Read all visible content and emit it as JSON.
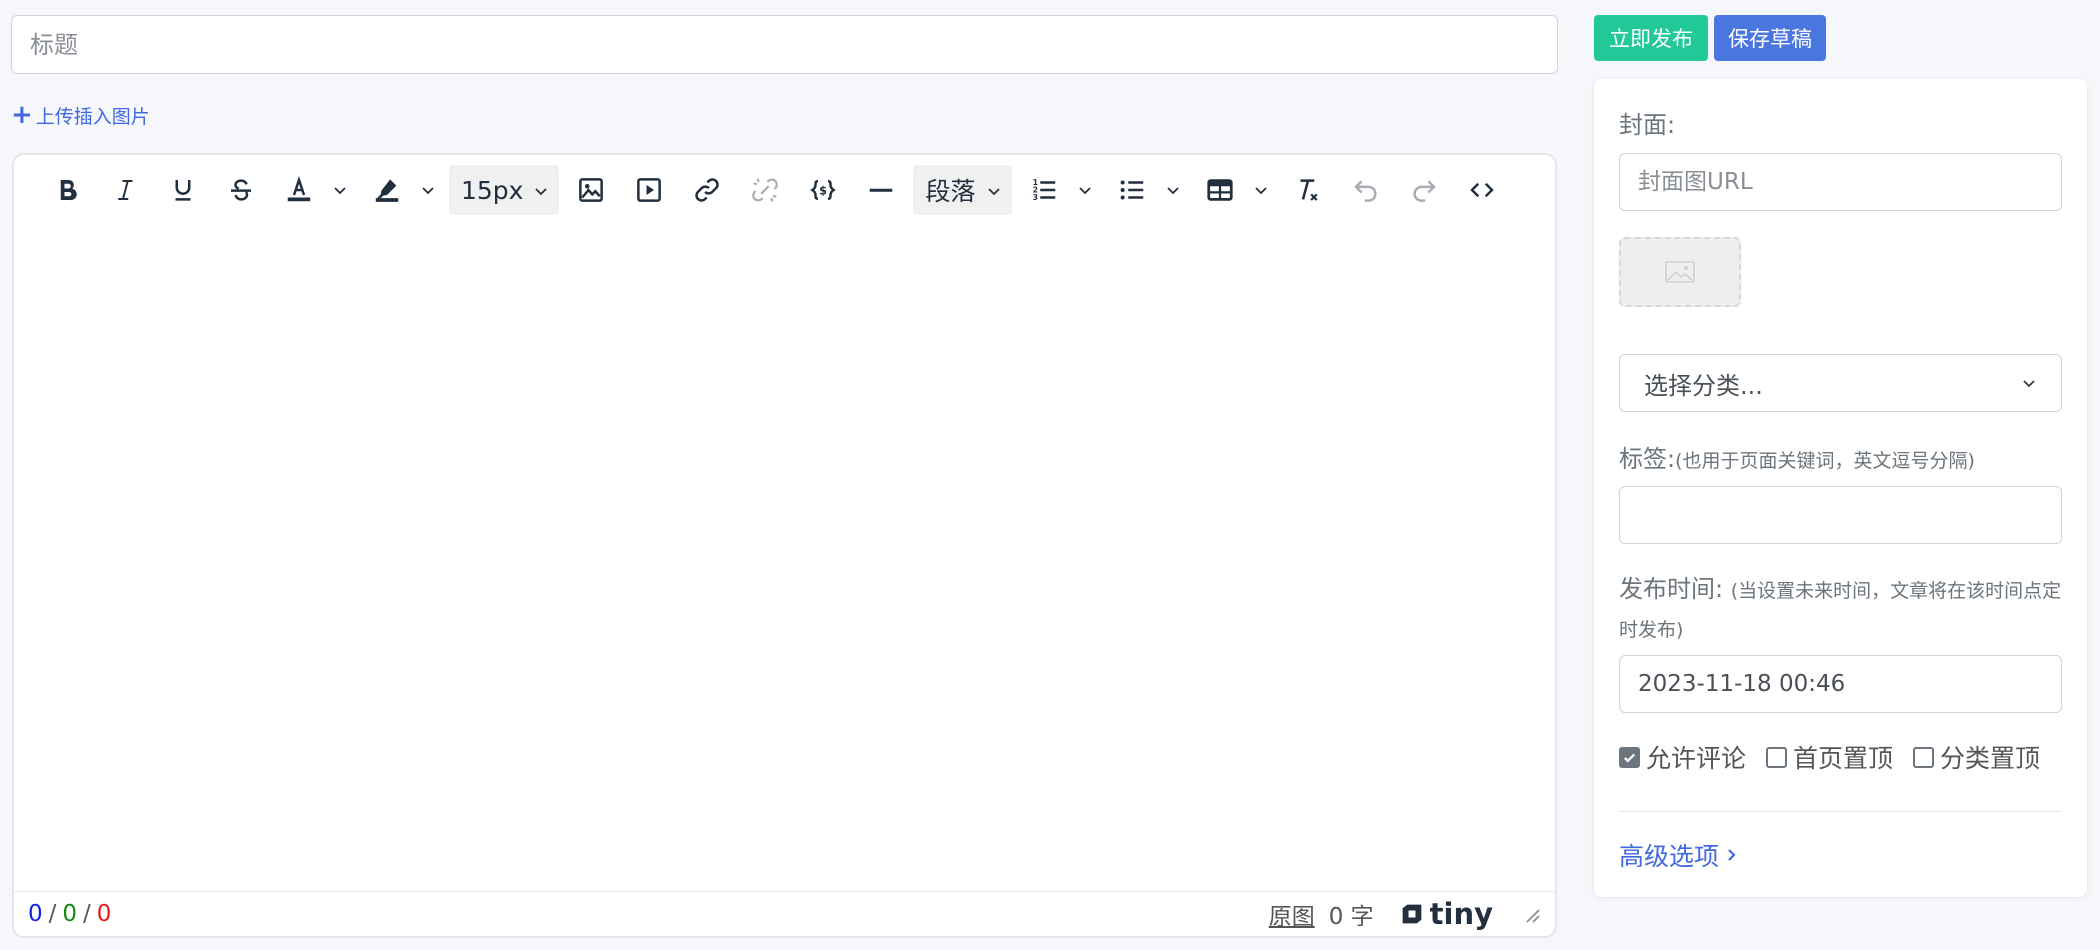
{
  "title_input": {
    "placeholder": "标题",
    "value": ""
  },
  "upload": {
    "label": "上传插入图片"
  },
  "toolbar": {
    "font_size": "15px",
    "block_format": "段落",
    "icons": [
      "bold-icon",
      "italic-icon",
      "underline-icon",
      "strikethrough-icon",
      "text-color-icon",
      "highlight-icon",
      "image-icon",
      "media-icon",
      "link-icon",
      "unlink-icon",
      "code-sample-icon",
      "horizontal-rule-icon",
      "numbered-list-icon",
      "bullet-list-icon",
      "table-icon",
      "remove-format-icon",
      "undo-icon",
      "redo-icon",
      "source-code-icon"
    ]
  },
  "statusbar": {
    "count_1": "0",
    "count_2": "0",
    "count_3": "0",
    "separator": "/",
    "raw_label": "原图",
    "word_count": "0 字",
    "brand": "tiny"
  },
  "actions": {
    "publish": "立即发布",
    "draft": "保存草稿"
  },
  "panel": {
    "cover_label": "封面:",
    "cover_placeholder": "封面图URL",
    "category_placeholder": "选择分类...",
    "tags_label": "标签:",
    "tags_hint": "(也用于页面关键词，英文逗号分隔)",
    "publish_time_label": "发布时间:",
    "publish_time_hint": "(当设置未来时间，文章将在该时间点定时发布)",
    "publish_time_value": "2023-11-18 00:46",
    "allow_comment": "允许评论",
    "home_top": "首页置顶",
    "category_top": "分类置顶",
    "allow_comment_checked": true,
    "home_top_checked": false,
    "category_top_checked": false,
    "advanced": "高级选项"
  },
  "colors": {
    "publish_button": "#20c997",
    "draft_button": "#4a76e0",
    "link": "#4169e1",
    "count_blue": "#1a22e0",
    "count_green": "#138a13",
    "count_red": "#e41a1a"
  }
}
